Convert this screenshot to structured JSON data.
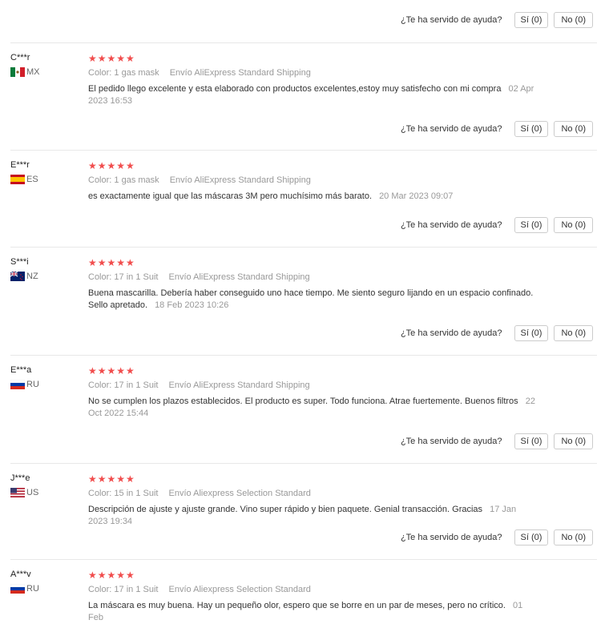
{
  "helpful_question": "¿Te ha servido de ayuda?",
  "yes_label": "Sí (0)",
  "no_label": "No (0)",
  "color_label": "Color:",
  "shipping_label": "Envío",
  "stars": "★★★★★",
  "reviews": [
    {
      "user": "C***r",
      "country": "MX",
      "color": "1 gas mask",
      "shipping": "AliExpress Standard Shipping",
      "text": "El pedido llego excelente y esta elaborado con productos excelentes,estoy muy satisfecho con mi compra",
      "date": "02 Apr 2023 16:53"
    },
    {
      "user": "E***r",
      "country": "ES",
      "color": "1 gas mask",
      "shipping": "AliExpress Standard Shipping",
      "text": "es exactamente igual que las máscaras 3M pero muchísimo más barato.",
      "date": "20 Mar 2023 09:07"
    },
    {
      "user": "S***i",
      "country": "NZ",
      "color": "17 in 1 Suit",
      "shipping": "AliExpress Standard Shipping",
      "text": "Buena mascarilla. Debería haber conseguido uno hace tiempo. Me siento seguro lijando en un espacio confinado. Sello apretado.",
      "date": "18 Feb 2023 10:26"
    },
    {
      "user": "E***a",
      "country": "RU",
      "color": "17 in 1 Suit",
      "shipping": "AliExpress Standard Shipping",
      "text": "No se cumplen los plazos establecidos. El producto es super. Todo funciona. Atrae fuertemente. Buenos filtros",
      "date": "22 Oct 2022 15:44"
    },
    {
      "user": "J***e",
      "country": "US",
      "color": "15 in 1 Suit",
      "shipping": "Aliexpress Selection Standard",
      "text": "Descripción de ajuste y ajuste grande. Vino super rápido y bien paquete. Genial transacción. Gracias",
      "date": "17 Jan 2023 19:34"
    },
    {
      "user": "A***v",
      "country": "RU",
      "color": "17 in 1 Suit",
      "shipping": "Aliexpress Selection Standard",
      "text": "La máscara es muy buena. Hay un pequeño olor, espero que se borre en un par de meses, pero no crítico.",
      "date": "01 Feb"
    }
  ]
}
